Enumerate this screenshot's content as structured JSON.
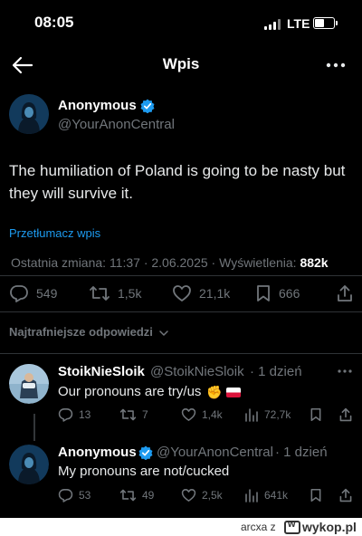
{
  "status_bar": {
    "time": "08:05",
    "network": "LTE",
    "icons": [
      "signal-icon",
      "battery-icon"
    ]
  },
  "nav": {
    "title": "Wpis",
    "back_icon": "arrow-left-icon",
    "more_icon": "more-horizontal-icon"
  },
  "post": {
    "author_name": "Anonymous",
    "author_handle": "@YourAnonCentral",
    "text": "The humiliation of Poland is going to be nasty but they will survive it.",
    "translate_label": "Przetłumacz wpis",
    "meta_prefix": "Ostatnia zmiana: 11:37 · 2.06.2025 · Wyświetlenia: ",
    "views": "882k",
    "actions": {
      "replies": "549",
      "reposts": "1,5k",
      "likes": "21,1k",
      "bookmarks": "666"
    }
  },
  "sort_label": "Najtrafniejsze odpowiedzi",
  "replies": [
    {
      "name": "StoikNieSloik",
      "handle": "@StoikNieSloik",
      "time": "· 1 dzień",
      "text": "Our pronouns are try/us",
      "emoji": [
        "fist-emoji",
        "poland-flag-emoji"
      ],
      "replies": "13",
      "reposts": "7",
      "likes": "1,4k",
      "views": "72,7k"
    },
    {
      "name": "Anonymous",
      "handle": "@YourAnonCentral",
      "time": "· 1 dzień",
      "text": "My pronouns are not/cucked",
      "replies": "53",
      "reposts": "49",
      "likes": "2,5k",
      "views": "641k"
    }
  ],
  "footer": {
    "credit": "arcxa z",
    "site": "wykop.pl"
  },
  "colors": {
    "background": "#000000",
    "accent": "#1d9bf0",
    "muted": "#71767b",
    "text": "#e7e9ea"
  }
}
